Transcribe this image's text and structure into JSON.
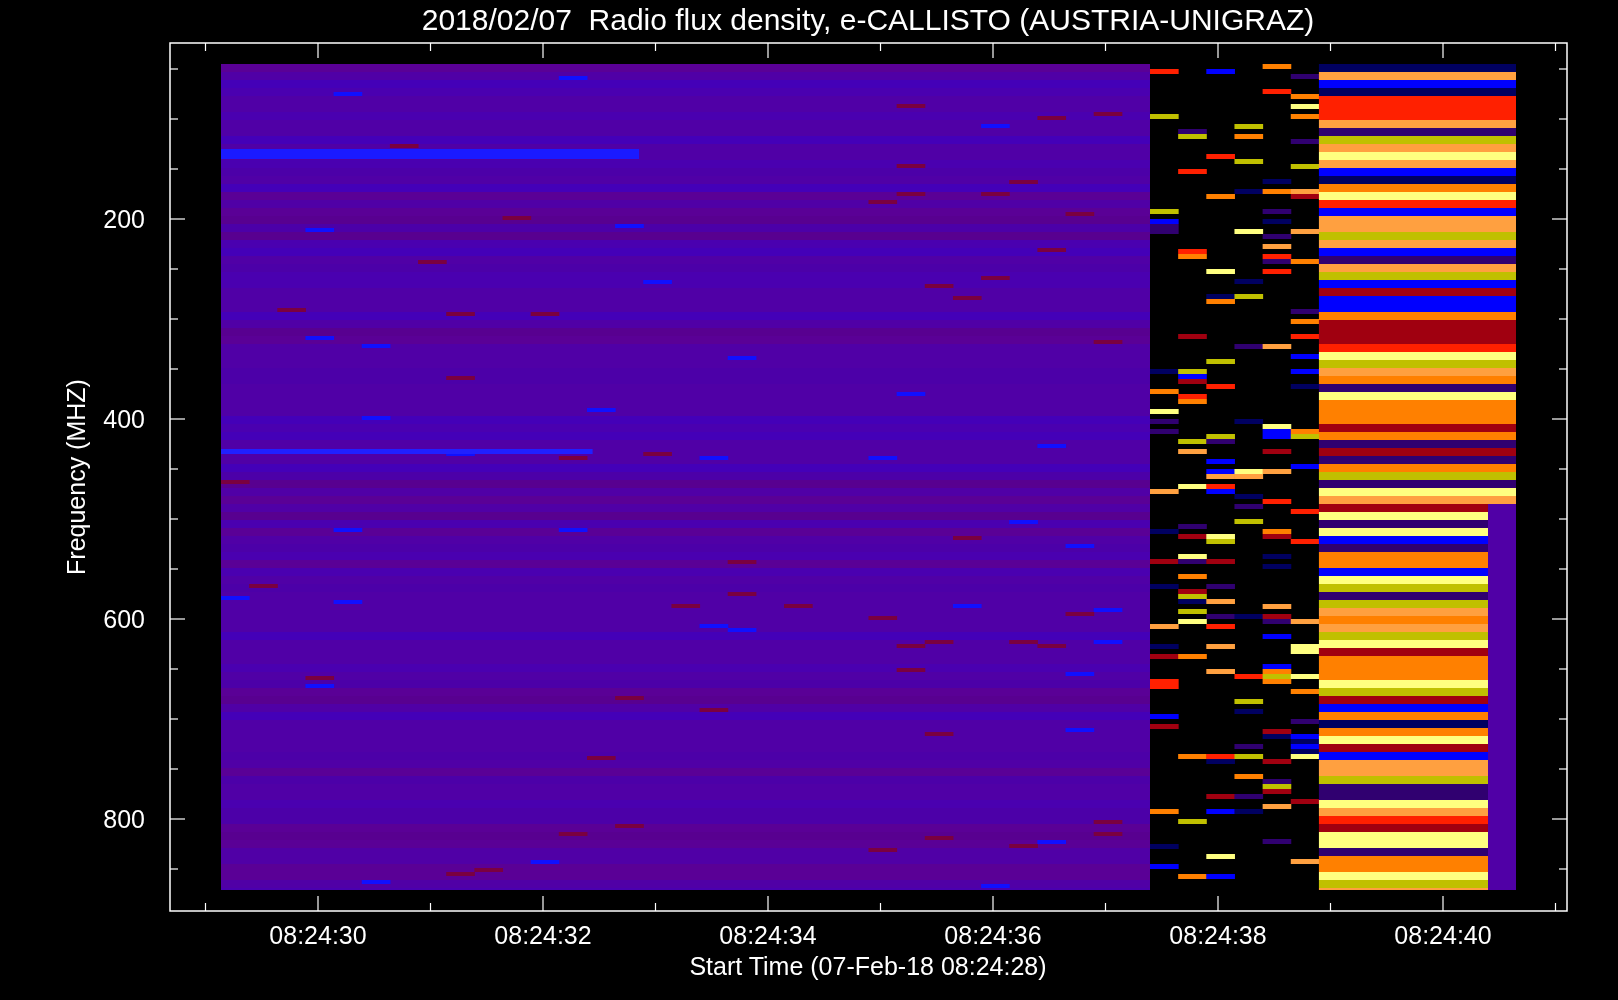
{
  "title": "2018/02/07  Radio flux density, e-CALLISTO (AUSTRIA-UNIGRAZ)",
  "y_axis": {
    "label": "Frequency (MHZ)",
    "ticks": [
      "200",
      "400",
      "600",
      "800"
    ]
  },
  "x_axis": {
    "label": "Start Time (07-Feb-18 08:24:28)",
    "ticks": [
      "08:24:30",
      "08:24:32",
      "08:24:34",
      "08:24:36",
      "08:24:38",
      "08:24:40"
    ]
  }
}
